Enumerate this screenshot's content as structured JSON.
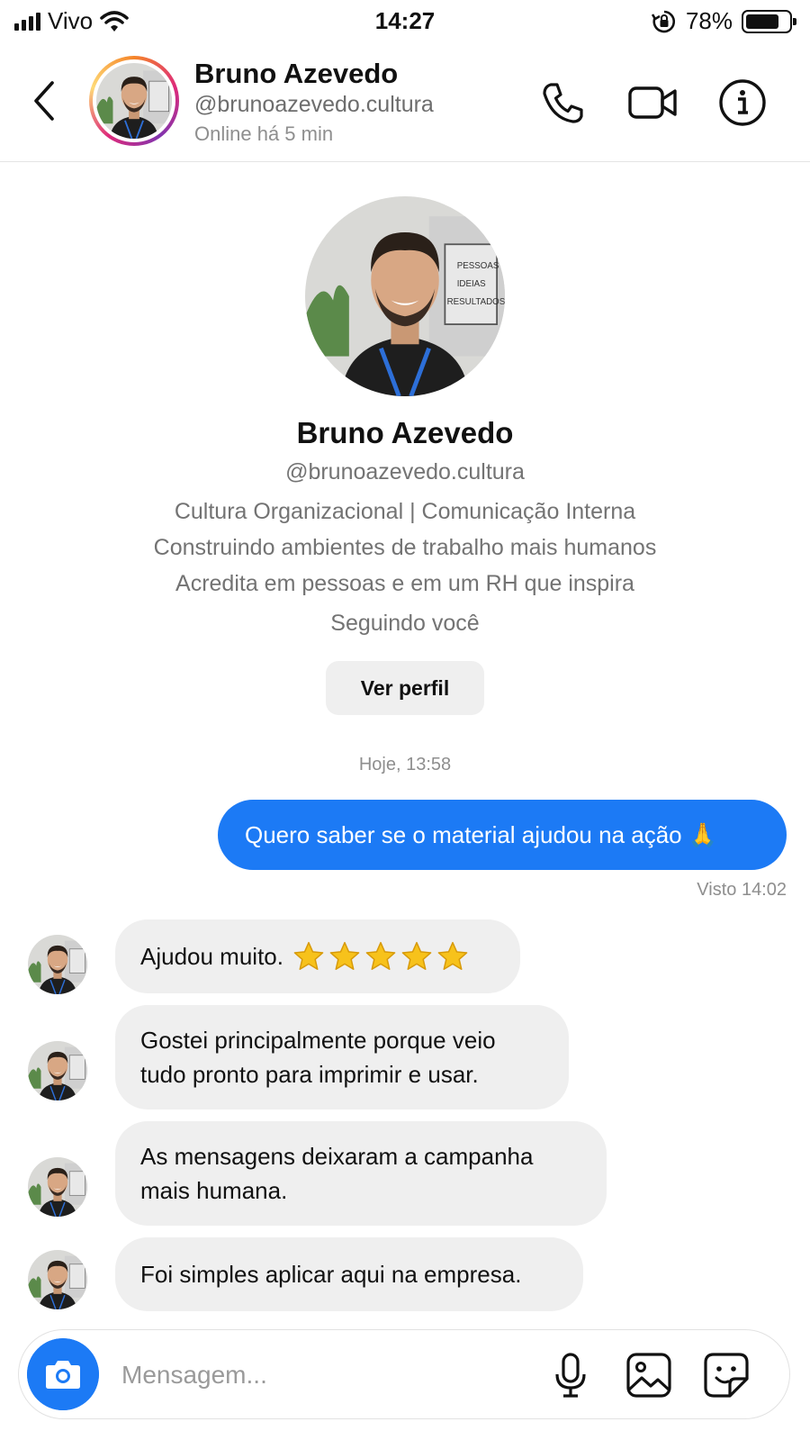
{
  "status_bar": {
    "carrier": "Vivo",
    "time": "14:27",
    "battery": "78%",
    "battery_level": 0.78
  },
  "header": {
    "name": "Bruno Azevedo",
    "handle": "@brunoazevedo.cultura",
    "online_status": "Online há 5 min",
    "icons": [
      "back-chevron",
      "phone-icon",
      "video-camera-icon",
      "info-icon"
    ]
  },
  "profile": {
    "name": "Bruno Azevedo",
    "handle": "@brunoazevedo.cultura",
    "bio_lines": [
      "Cultura Organizacional | Comunicação Interna",
      "Construindo ambientes de trabalho mais humanos",
      "Acredita em pessoas e em um RH que inspira"
    ],
    "follow_status": "Seguindo você",
    "view_profile_label": "Ver perfil",
    "photo_sign": [
      "PESSOAS",
      "IDEIAS",
      "RESULTADOS"
    ]
  },
  "chat": {
    "timestamp": "Hoje, 13:58",
    "outgoing": {
      "text": "Quero saber se o material ajudou na ação 🙏",
      "seen": "Visto 14:02"
    },
    "incoming": [
      {
        "text": "Ajudou muito.",
        "stars": 5
      },
      {
        "text": "Gostei principalmente porque veio tudo pronto para imprimir e usar."
      },
      {
        "text": "As mensagens deixaram a campanha mais humana."
      },
      {
        "text": "Foi simples aplicar aqui na empresa."
      }
    ]
  },
  "composer": {
    "placeholder": "Mensagem...",
    "icons": [
      "camera-icon",
      "microphone-icon",
      "gallery-icon",
      "sticker-icon"
    ]
  },
  "colors": {
    "accent_blue": "#1c7af5",
    "bubble_gray": "#efefef",
    "secondary_text": "#737373"
  }
}
